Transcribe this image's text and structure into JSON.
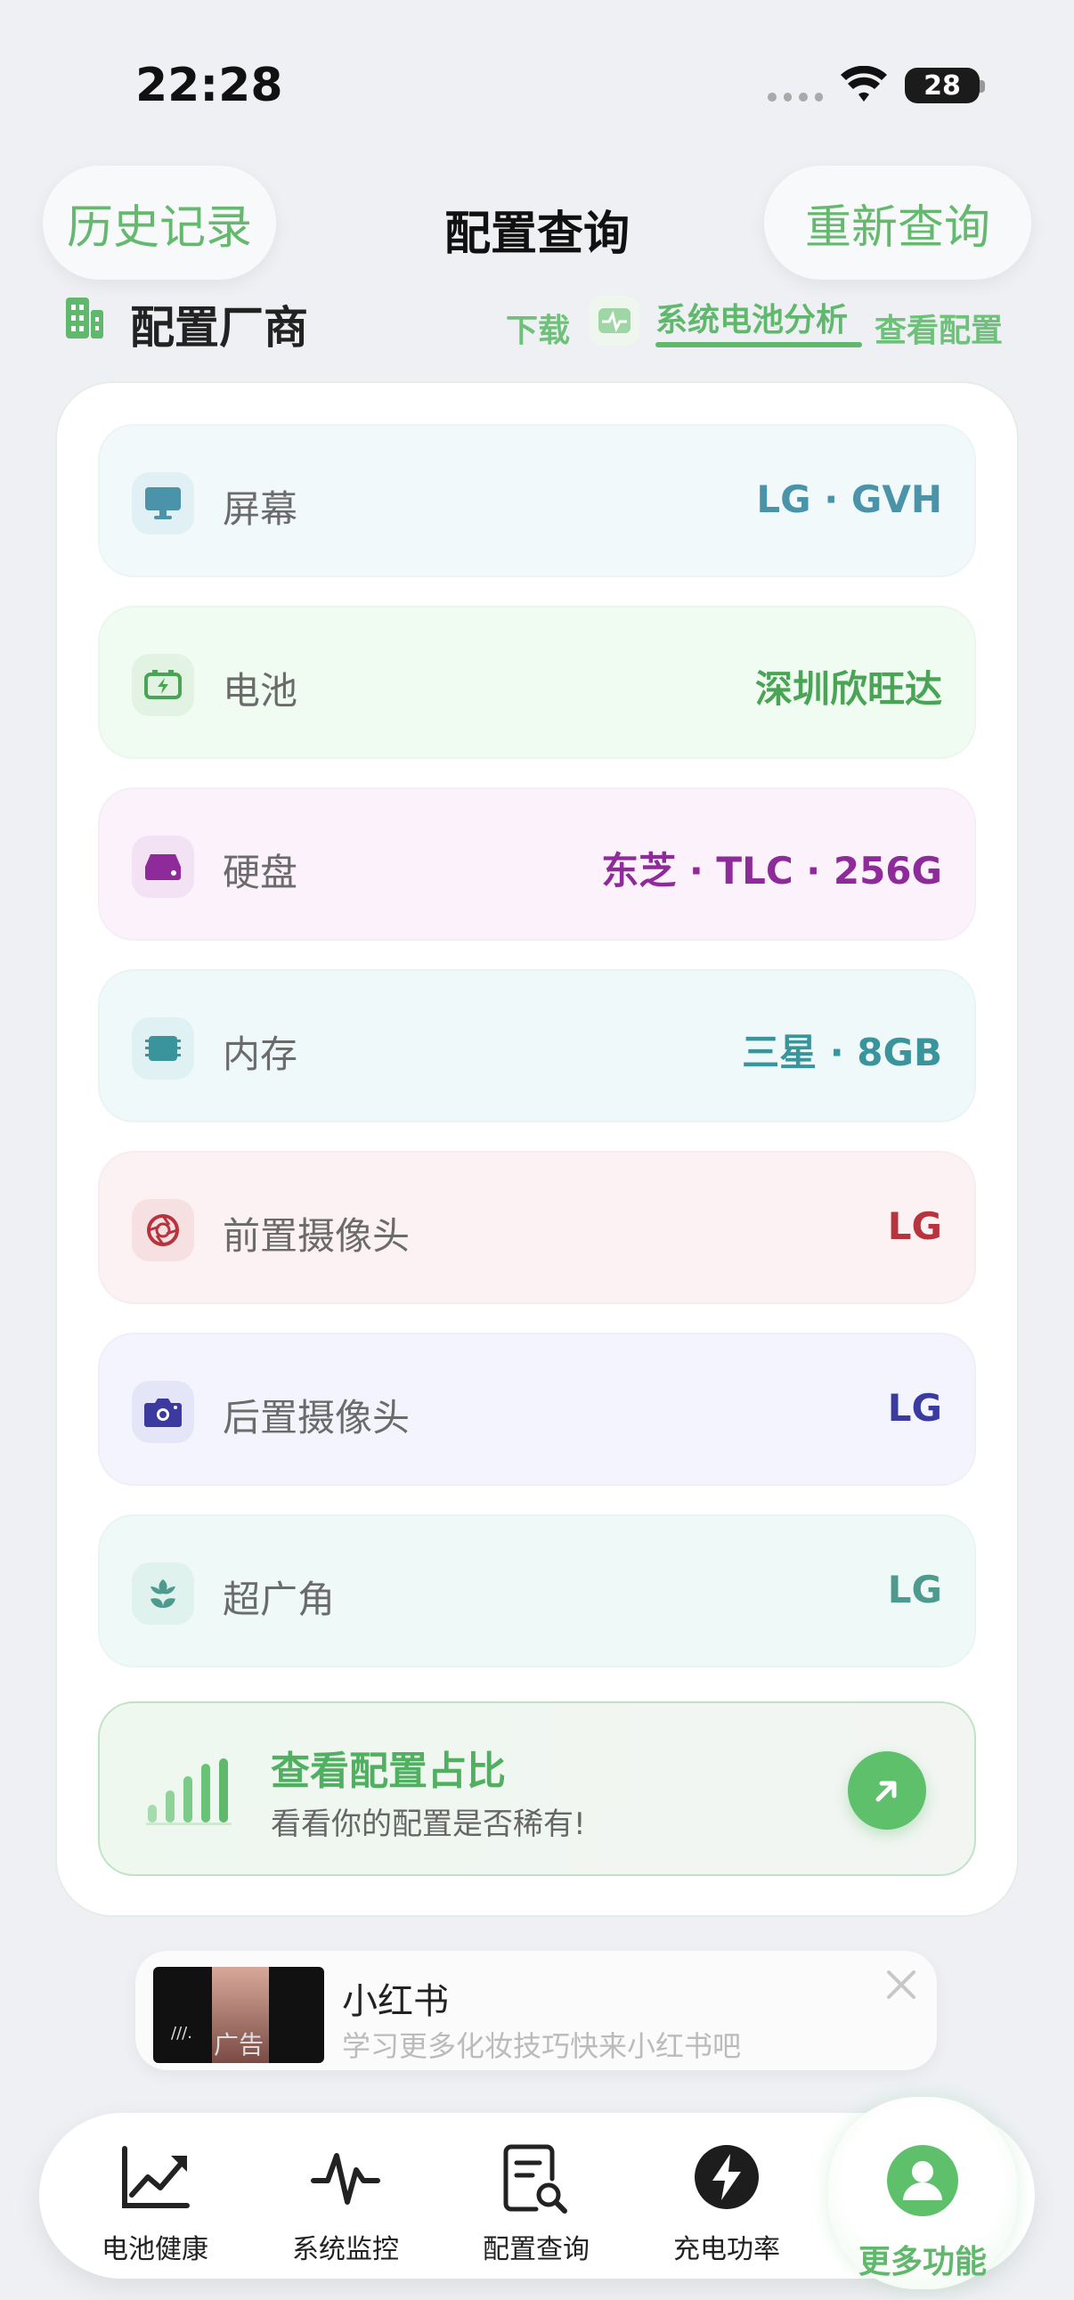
{
  "status_bar": {
    "time": "22:28",
    "battery": "28"
  },
  "header": {
    "history_label": "历史记录",
    "title": "配置查询",
    "requery_label": "重新查询"
  },
  "vendor_section": {
    "title": "配置厂商",
    "tabs": {
      "download": "下载",
      "battery_analysis": "系统电池分析",
      "view_config": "查看配置"
    }
  },
  "specs": [
    {
      "label": "屏幕",
      "value": "LG · GVH",
      "color": "#4a93a8",
      "bg": "#f1f9fb",
      "icon": "monitor-icon"
    },
    {
      "label": "电池",
      "value": "深圳欣旺达",
      "color": "#4aa455",
      "bg": "#f0fbf1",
      "icon": "battery-charging-icon"
    },
    {
      "label": "硬盘",
      "value": "东芝 · TLC · 256G",
      "color": "#8e2a99",
      "bg": "#fbf2fb",
      "icon": "hard-drive-icon"
    },
    {
      "label": "内存",
      "value": "三星 · 8GB",
      "color": "#3a949c",
      "bg": "#eff9fa",
      "icon": "memory-chip-icon"
    },
    {
      "label": "前置摄像头",
      "value": "LG",
      "color": "#b7333d",
      "bg": "#fdf2f3",
      "icon": "aperture-icon"
    },
    {
      "label": "后置摄像头",
      "value": "LG",
      "color": "#3a3aa0",
      "bg": "#f3f4fd",
      "icon": "camera-icon"
    },
    {
      "label": "超广角",
      "value": "LG",
      "color": "#4e9a8e",
      "bg": "#eff9f7",
      "icon": "macro-flower-icon"
    }
  ],
  "ratio_card": {
    "title": "查看配置占比",
    "subtitle": "看看你的配置是否稀有!"
  },
  "ad": {
    "title": "小红书",
    "subtitle": "学习更多化妆技巧快来小红书吧",
    "badge": "广告"
  },
  "tabbar": [
    {
      "label": "电池健康",
      "icon": "trend-chart-icon"
    },
    {
      "label": "系统监控",
      "icon": "pulse-icon"
    },
    {
      "label": "配置查询",
      "icon": "document-search-icon"
    },
    {
      "label": "充电功率",
      "icon": "bolt-icon"
    },
    {
      "label": "更多功能",
      "icon": "user-icon",
      "active": true
    }
  ],
  "colors": {
    "accent": "#5fb86b",
    "background": "#eef0f4"
  }
}
